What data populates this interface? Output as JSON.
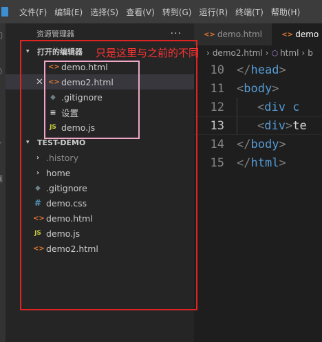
{
  "menubar": {
    "items": [
      "文件(F)",
      "编辑(E)",
      "选择(S)",
      "查看(V)",
      "转到(G)",
      "运行(R)",
      "终端(T)",
      "帮助(H)"
    ]
  },
  "sidebar": {
    "title": "资源管理器",
    "more": "···",
    "open_editors": {
      "label": "打开的编辑器",
      "items": [
        {
          "label": "demo.html",
          "icon": "html-file-icon"
        },
        {
          "label": "demo2.html",
          "icon": "html-file-icon",
          "close": "✕"
        },
        {
          "label": ".gitignore",
          "icon": "git-file-icon"
        },
        {
          "label": "设置",
          "icon": "settings-icon"
        },
        {
          "label": "demo.js",
          "icon": "js-file-icon"
        }
      ]
    },
    "workspace": {
      "label": "TEST-DEMO",
      "items": [
        {
          "label": ".history",
          "icon": "folder-chevron-icon"
        },
        {
          "label": "home",
          "icon": "folder-chevron-icon"
        },
        {
          "label": ".gitignore",
          "icon": "git-file-icon"
        },
        {
          "label": "demo.css",
          "icon": "css-file-icon"
        },
        {
          "label": "demo.html",
          "icon": "html-file-icon"
        },
        {
          "label": "demo.js",
          "icon": "js-file-icon"
        },
        {
          "label": "demo2.html",
          "icon": "html-file-icon"
        }
      ]
    }
  },
  "annotation": "只是这里与之前的不同",
  "editor": {
    "tabs": [
      {
        "label": "demo.html",
        "active": false
      },
      {
        "label": "demo",
        "active": true
      }
    ],
    "breadcrumb": [
      "demo2.html",
      "html",
      "b"
    ],
    "lines": [
      {
        "num": "10",
        "open": "</",
        "tag": "head",
        "close": ">",
        "text": ""
      },
      {
        "num": "11",
        "open": "<",
        "tag": "body",
        "close": ">",
        "text": ""
      },
      {
        "num": "12",
        "open": "<",
        "tag": "div c",
        "close": "",
        "text": ""
      },
      {
        "num": "13",
        "open": "<",
        "tag": "div",
        "close": ">",
        "text": "te"
      },
      {
        "num": "14",
        "open": "</",
        "tag": "body",
        "close": ">",
        "text": ""
      },
      {
        "num": "15",
        "open": "</",
        "tag": "html",
        "close": ">",
        "text": ""
      }
    ]
  },
  "colors": {
    "annotation_red": "#e02424",
    "annotation_pink": "#f0a7c8",
    "html_icon": "#e37933",
    "css_icon": "#519aba",
    "js_icon": "#cbcb41",
    "tag": "#569cd6"
  }
}
